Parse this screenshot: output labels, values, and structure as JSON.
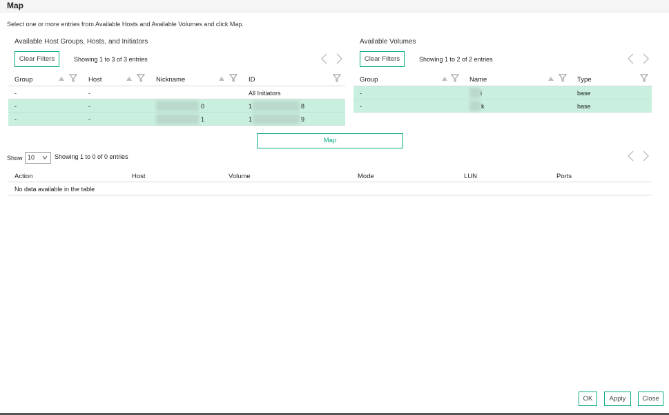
{
  "dialog": {
    "title": "Map",
    "instruction": "Select one or more entries from Available Hosts and Available Volumes and click Map."
  },
  "hosts_panel": {
    "title": "Available Host Groups, Hosts, and Initiators",
    "clear_filters": "Clear Filters",
    "showing": "Showing 1 to 3 of 3 entries",
    "columns": [
      "Group",
      "Host",
      "Nickname",
      "ID"
    ],
    "rows": [
      {
        "group": "-",
        "host": "-",
        "nickname": "",
        "id": "All Initiators",
        "selected": false
      },
      {
        "group": "-",
        "host": "-",
        "nickname": "0",
        "id": "8",
        "id_prefix": "1",
        "selected": true
      },
      {
        "group": "-",
        "host": "-",
        "nickname": "1",
        "id": "9",
        "id_prefix": "1",
        "selected": true
      }
    ]
  },
  "volumes_panel": {
    "title": "Available Volumes",
    "clear_filters": "Clear Filters",
    "showing": "Showing 1 to 2 of 2 entries",
    "columns": [
      "Group",
      "Name",
      "Type"
    ],
    "rows": [
      {
        "group": "-",
        "name": "i",
        "type": "base",
        "selected": true
      },
      {
        "group": "-",
        "name": "k",
        "type": "base",
        "selected": true
      }
    ]
  },
  "map_button": "Map",
  "mappings": {
    "show_label": "Show",
    "page_size": "10",
    "showing": "Showing 1 to 0 of 0 entries",
    "columns": [
      "Action",
      "Host",
      "Volume",
      "Mode",
      "LUN",
      "Ports"
    ],
    "empty": "No data available in the table"
  },
  "footer": {
    "ok": "OK",
    "apply": "Apply",
    "close": "Close"
  },
  "colors": {
    "accent": "#01a982",
    "selected_row": "#c9f0df"
  },
  "icons": [
    "sort-up-icon",
    "filter-icon",
    "chevron-left-icon",
    "chevron-right-icon",
    "chevron-down-icon"
  ]
}
